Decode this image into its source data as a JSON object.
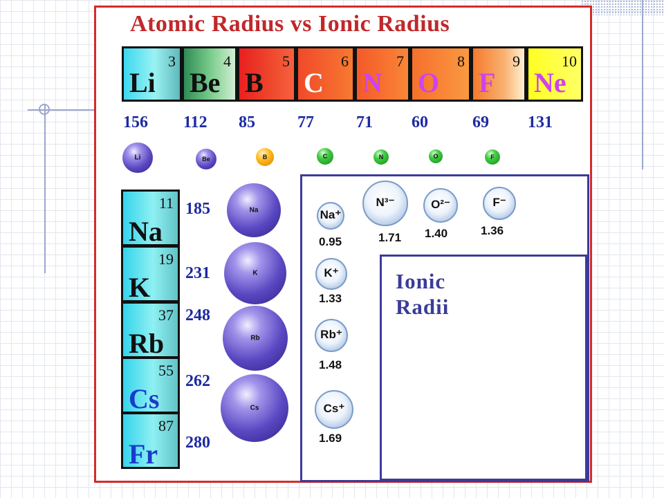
{
  "title": "Atomic Radius vs Ionic Radius",
  "period2": [
    {
      "symbol": "Li",
      "number": "3",
      "radius": "156",
      "sym_color": "#111111"
    },
    {
      "symbol": "Be",
      "number": "4",
      "radius": "112",
      "sym_color": "#111111"
    },
    {
      "symbol": "B",
      "number": "5",
      "radius": "85",
      "sym_color": "#111111"
    },
    {
      "symbol": "C",
      "number": "6",
      "radius": "77",
      "sym_color": "#ffffff"
    },
    {
      "symbol": "N",
      "number": "7",
      "radius": "71",
      "sym_color": "#cc44ee"
    },
    {
      "symbol": "O",
      "number": "8",
      "radius": "60",
      "sym_color": "#cc44ee"
    },
    {
      "symbol": "F",
      "number": "9",
      "radius": "69",
      "sym_color": "#cc44ee"
    },
    {
      "symbol": "Ne",
      "number": "10",
      "radius": "131",
      "sym_color": "#cc44ee"
    }
  ],
  "period2_atoms": [
    {
      "label": "Li",
      "style": "purple"
    },
    {
      "label": "Be",
      "style": "purple"
    },
    {
      "label": "B",
      "style": "orange"
    },
    {
      "label": "C",
      "style": "green"
    },
    {
      "label": "N",
      "style": "green"
    },
    {
      "label": "O",
      "style": "green"
    },
    {
      "label": "F",
      "style": "green"
    }
  ],
  "group1": [
    {
      "symbol": "Na",
      "number": "11",
      "radius": "185",
      "sym_color": "#111111"
    },
    {
      "symbol": "K",
      "number": "19",
      "radius": "231",
      "sym_color": "#111111"
    },
    {
      "symbol": "Rb",
      "number": "37",
      "radius": "248",
      "sym_color": "#111111"
    },
    {
      "symbol": "Cs",
      "number": "55",
      "radius": "262",
      "sym_color": "#1a3acc"
    },
    {
      "symbol": "Fr",
      "number": "87",
      "radius": "280",
      "sym_color": "#1a3acc"
    }
  ],
  "group1_atoms": [
    {
      "label": "Na"
    },
    {
      "label": "K"
    },
    {
      "label": "Rb"
    },
    {
      "label": "Cs"
    }
  ],
  "cations": [
    {
      "label": "Na⁺",
      "value": "0.95"
    },
    {
      "label": "K⁺",
      "value": "1.33"
    },
    {
      "label": "Rb⁺",
      "value": "1.48"
    },
    {
      "label": "Cs⁺",
      "value": "1.69"
    }
  ],
  "anions": [
    {
      "label": "N³⁻",
      "value": "1.71"
    },
    {
      "label": "O²⁻",
      "value": "1.40"
    },
    {
      "label": "F⁻",
      "value": "1.36"
    }
  ],
  "ionic_box": {
    "line1": "Ionic",
    "line2": "Radii"
  },
  "colors": {
    "panel_border": "#d42a2a",
    "title": "#c0282a",
    "value_text": "#1c2aa0",
    "ionic_box": "#3a3c9a"
  }
}
